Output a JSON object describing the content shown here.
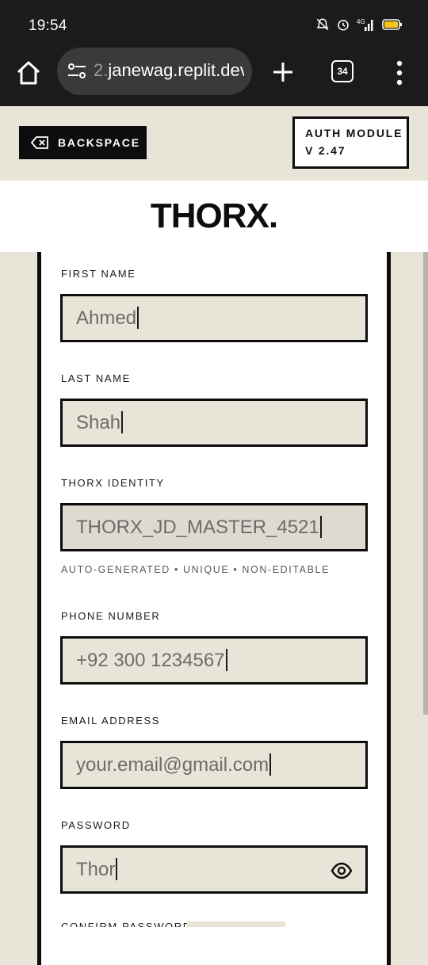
{
  "status_bar": {
    "time": "19:54",
    "icons": [
      "bell-muted-icon",
      "alarm-icon",
      "signal-4g-icon",
      "battery-icon"
    ],
    "network": "4G"
  },
  "browser": {
    "url_faded": "2.",
    "url": "janewag.replit.dev",
    "tab_count": "34",
    "icons": [
      "home-icon",
      "site-settings-icon",
      "plus-icon",
      "tabs-icon",
      "more-vert-icon"
    ]
  },
  "header": {
    "backspace_label": "BACKSPACE",
    "auth_title": "AUTH MODULE",
    "auth_version": "V 2.47"
  },
  "logo": "THORX.",
  "form": {
    "first_name": {
      "label": "FIRST NAME",
      "value": "Ahmed"
    },
    "last_name": {
      "label": "LAST NAME",
      "value": "Shah"
    },
    "identity": {
      "label": "THORX IDENTITY",
      "value": "THORX_JD_MASTER_4521",
      "hint": "AUTO-GENERATED • UNIQUE • NON-EDITABLE"
    },
    "phone": {
      "label": "PHONE NUMBER",
      "value": "+92 300 1234567"
    },
    "email": {
      "label": "EMAIL ADDRESS",
      "placeholder": "your.email@gmail.com"
    },
    "password": {
      "label": "PASSWORD",
      "value": "Thor"
    },
    "confirm_password": {
      "label": "CONFIRM PASSWORD"
    }
  },
  "colors": {
    "background": "#e8e4d8",
    "ink": "#0d0d0d",
    "card": "#ffffff",
    "status_bar": "#1b1b1b",
    "battery": "#f5c518"
  }
}
